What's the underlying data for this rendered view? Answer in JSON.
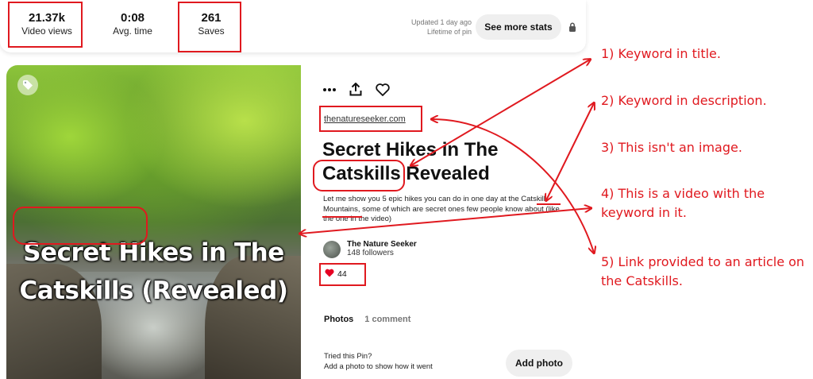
{
  "stats": {
    "views_value": "21.37k",
    "views_label": "Video views",
    "time_value": "0:08",
    "time_label": "Avg. time",
    "saves_value": "261",
    "saves_label": "Saves",
    "updated_line1": "Updated 1 day ago",
    "updated_line2": "Lifetime of pin",
    "see_more_label": "See more stats",
    "lock_icon": "lock-icon"
  },
  "pin": {
    "overlay_line1": "Secret Hikes in The",
    "overlay_line2_keyword": "Catskills",
    "overlay_line2_rest": " (Revealed)",
    "tag_icon": "tag-icon"
  },
  "details": {
    "action_icons": [
      "more-icon",
      "share-icon",
      "heart-icon"
    ],
    "site_link": "thenatureseeker.com",
    "title_part1": "Secret Hikes in The",
    "title_keyword": "Catskills",
    "title_part2": " Revealed",
    "desc_part1": "Let me show you 5 epic hikes you can do in one day at the ",
    "desc_keyword": "Catskill Mountains",
    "desc_part2": ", some of which are secret ones few people know about (like the one in the video)",
    "creator_name": "The Nature Seeker",
    "creator_followers": "148 followers",
    "reaction_icon": "heart-reaction-icon",
    "reaction_count": "44",
    "tab_photos": "Photos",
    "tab_comments": "1 comment",
    "tried_line1": "Tried this Pin?",
    "tried_line2": "Add a photo to show how it went",
    "add_photo_label": "Add photo"
  },
  "annotations": [
    "1) Keyword in title.",
    "2) Keyword in description.",
    "3) This isn't an image.",
    "4) This is a video with the keyword in it.",
    "5) Link provided to an article on the Catskills."
  ],
  "colors": {
    "annotation_red": "#e0191f",
    "button_gray": "#efefef",
    "reaction_red": "#e60023"
  }
}
